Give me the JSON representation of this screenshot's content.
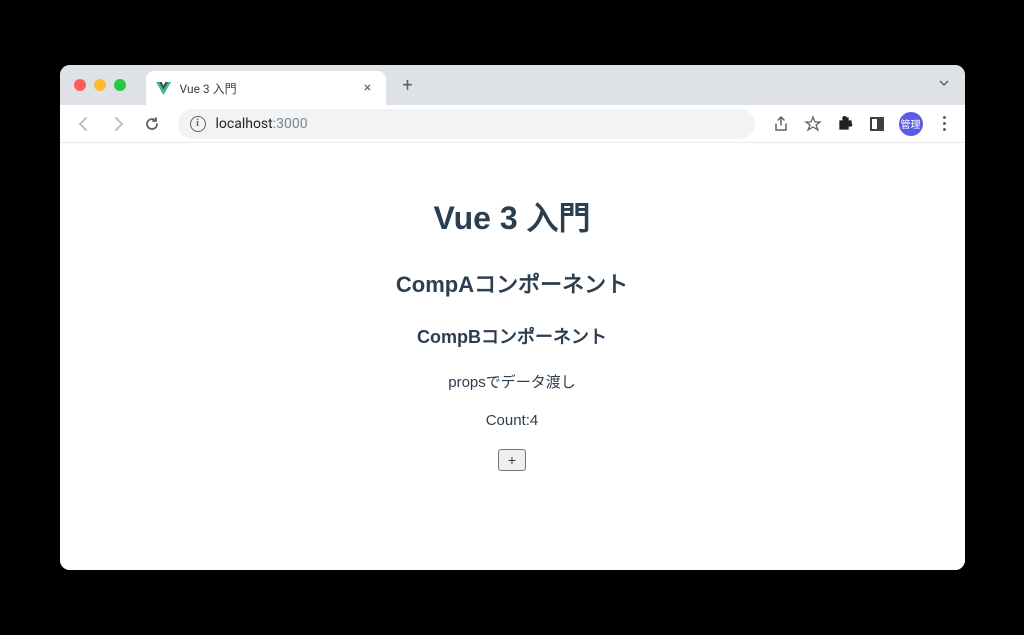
{
  "browser": {
    "tab": {
      "title": "Vue 3 入門"
    },
    "url": {
      "host": "localhost",
      "port": ":3000"
    },
    "avatar_label": "管理"
  },
  "page": {
    "heading": "Vue 3 入門",
    "compA": "CompAコンポーネント",
    "compB": "CompBコンポーネント",
    "props_text": "propsでデータ渡し",
    "count_label": "Count:4",
    "button_label": "+"
  }
}
